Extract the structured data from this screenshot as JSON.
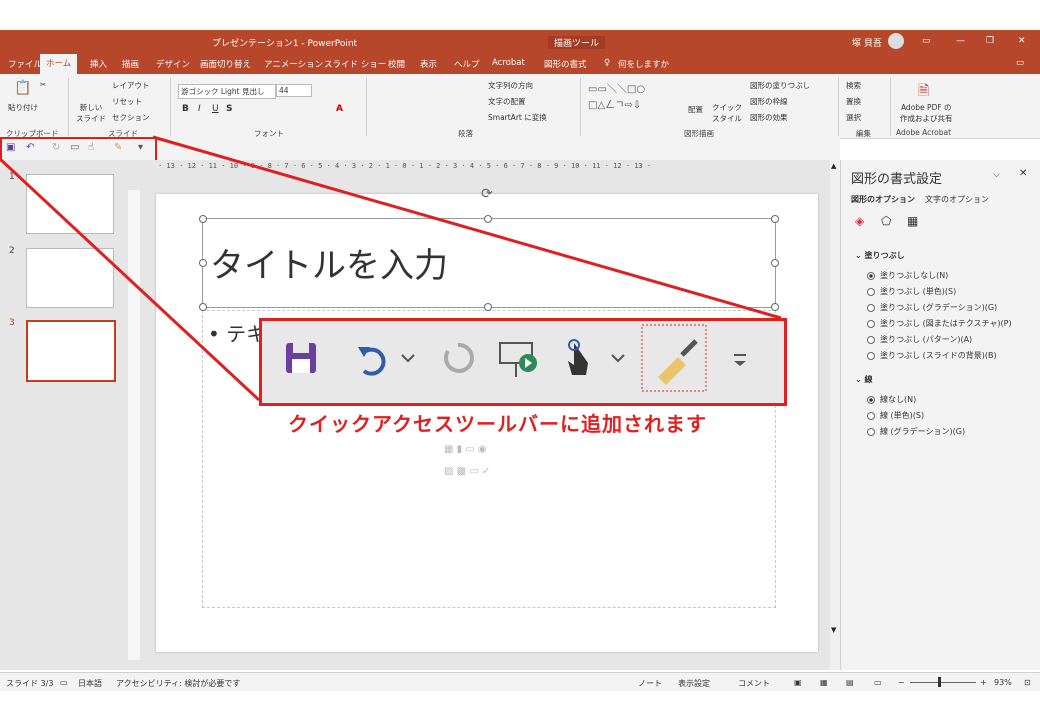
{
  "window": {
    "title": "プレゼンテーション1 - PowerPoint",
    "context_tool": "描画ツール",
    "user_name": "塚 貝吾",
    "min": "—",
    "max": "❐",
    "close": "✕"
  },
  "tabs": [
    {
      "label": "ファイル"
    },
    {
      "label": "ホーム"
    },
    {
      "label": "挿入"
    },
    {
      "label": "描画"
    },
    {
      "label": "デザイン"
    },
    {
      "label": "画面切り替え"
    },
    {
      "label": "アニメーション"
    },
    {
      "label": "スライド ショー"
    },
    {
      "label": "校閲"
    },
    {
      "label": "表示"
    },
    {
      "label": "ヘルプ"
    },
    {
      "label": "Acrobat"
    },
    {
      "label": "図形の書式"
    }
  ],
  "tell_me": "何をしますか",
  "ribbon": {
    "paste": "貼り付け",
    "new_slide": "新しい\nスライド",
    "layout": "レイアウト",
    "reset": "リセット",
    "section": "セクション",
    "font_name": "游ゴシック Light 見出し",
    "font_size": "44",
    "text_direction": "文字列の方向",
    "align_text": "文字の配置",
    "smartart": "SmartArt に変換",
    "arrange": "配置",
    "quick_style": "クイック\nスタイル",
    "shape_fill": "図形の塗りつぶし",
    "shape_outline": "図形の枠線",
    "shape_effects": "図形の効果",
    "find": "検索",
    "replace": "置換",
    "select": "選択",
    "adobe_pdf": "Adobe PDF の\n作成および共有",
    "groups": {
      "clipboard": "クリップボード",
      "slides": "スライド",
      "font": "フォント",
      "paragraph": "段落",
      "drawing": "図形描画",
      "editing": "編集",
      "acrobat": "Adobe Acrobat"
    }
  },
  "slides": [
    {
      "num": "1"
    },
    {
      "num": "2"
    },
    {
      "num": "3"
    }
  ],
  "slide": {
    "title_placeholder": "タイトルを入力",
    "bullet_text": "• テキ"
  },
  "ruler": {
    "h": "· 13 · 12 · 11 · 10 · 9 · 8 · 7 · 6 · 5 · 4 · 3 · 2 · 1 · 0 · 1 · 2 · 3 · 4 · 5 · 6 · 7 · 8 · 9 · 10 · 11 · 12 · 13 ·"
  },
  "callout": {
    "label": "クイックアクセスツールバーに追加されます"
  },
  "format_pane": {
    "title": "図形の書式設定",
    "tab_shape": "図形のオプション",
    "tab_text": "文字のオプション",
    "fill_header": "塗りつぶし",
    "fill_options": [
      {
        "label": "塗りつぶしなし(N)",
        "on": true
      },
      {
        "label": "塗りつぶし (単色)(S)",
        "on": false
      },
      {
        "label": "塗りつぶし (グラデーション)(G)",
        "on": false
      },
      {
        "label": "塗りつぶし (図またはテクスチャ)(P)",
        "on": false
      },
      {
        "label": "塗りつぶし (パターン)(A)",
        "on": false
      },
      {
        "label": "塗りつぶし (スライドの背景)(B)",
        "on": false
      }
    ],
    "line_header": "線",
    "line_options": [
      {
        "label": "線なし(N)",
        "on": true
      },
      {
        "label": "線 (単色)(S)",
        "on": false
      },
      {
        "label": "線 (グラデーション)(G)",
        "on": false
      }
    ]
  },
  "status": {
    "slide": "スライド 3/3",
    "language": "日本語",
    "accessibility": "アクセシビリティ: 検討が必要です",
    "notes": "ノート",
    "display_settings": "表示設定",
    "comments": "コメント",
    "zoom": "93%"
  },
  "colors": {
    "accent": "#b7472a",
    "callout": "#e02020"
  }
}
